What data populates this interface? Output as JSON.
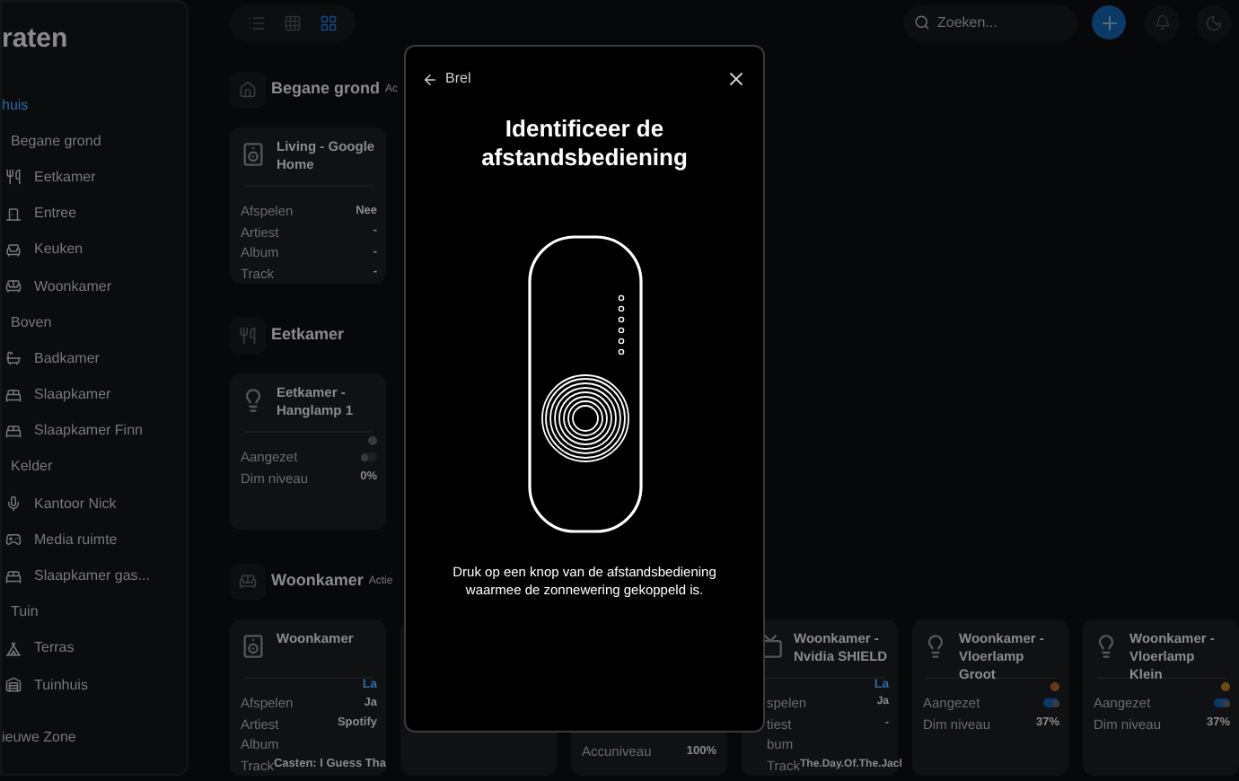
{
  "sidebar": {
    "title": "raten",
    "items": [
      {
        "label": "huis",
        "kind": "home",
        "selected": true
      },
      {
        "label": "Begane grond",
        "kind": "group",
        "selected": false
      },
      {
        "label": "Eetkamer",
        "kind": "room",
        "selected": false
      },
      {
        "label": "Entree",
        "kind": "room",
        "selected": false
      },
      {
        "label": "Keuken",
        "kind": "room",
        "selected": false
      },
      {
        "label": "Woonkamer",
        "kind": "room",
        "selected": false
      },
      {
        "label": "Boven",
        "kind": "group",
        "selected": false
      },
      {
        "label": "Badkamer",
        "kind": "room",
        "selected": false
      },
      {
        "label": "Slaapkamer",
        "kind": "room",
        "selected": false
      },
      {
        "label": "Slaapkamer Finn",
        "kind": "room",
        "selected": false
      },
      {
        "label": "Kelder",
        "kind": "group",
        "selected": false
      },
      {
        "label": "Kantoor Nick",
        "kind": "room",
        "selected": false
      },
      {
        "label": "Media ruimte",
        "kind": "room",
        "selected": false
      },
      {
        "label": "Slaapkamer gas...",
        "kind": "room",
        "selected": false
      },
      {
        "label": "Tuin",
        "kind": "group",
        "selected": false
      },
      {
        "label": "Terras",
        "kind": "room",
        "selected": false
      },
      {
        "label": "Tuinhuis",
        "kind": "room",
        "selected": false
      }
    ],
    "footer": "ieuwe Zone"
  },
  "toolbar": {
    "views": [
      {
        "selected": false
      },
      {
        "selected": false
      },
      {
        "selected": true
      }
    ],
    "search": {
      "placeholder": "Zoeken..."
    }
  },
  "sections": [
    {
      "title": "Begane grond",
      "action": "Ac",
      "cards": [
        {
          "kind": "media",
          "title": "Living - Google Home",
          "rows": [
            {
              "label": "Afspelen",
              "value": "Nee"
            },
            {
              "label": "Artiest",
              "value": "-"
            },
            {
              "label": "Album",
              "value": "-"
            },
            {
              "label": "Track",
              "value": "-"
            }
          ]
        }
      ]
    },
    {
      "title": "Eetkamer",
      "cards": [
        {
          "kind": "light",
          "title": "Eetkamer - Hanglamp 1",
          "color": "#3a3a3a",
          "on": false,
          "rows": [
            {
              "label": "Aangezet"
            },
            {
              "label": "Dim niveau",
              "value": "0%"
            }
          ]
        }
      ]
    },
    {
      "title": "Woonkamer",
      "action": "Actie",
      "cards": [
        {
          "kind": "media",
          "title": "Woonkamer",
          "status": "La",
          "rows": [
            {
              "label": "Afspelen",
              "value": "Ja"
            },
            {
              "label": "Artiest",
              "value": "Spotify"
            },
            {
              "label": "Album"
            },
            {
              "label": "Track",
              "value": "Casten: I Guess Tha"
            }
          ]
        },
        {
          "kind": "hidden"
        },
        {
          "kind": "battery",
          "rows": [
            {
              "label": "Accuniveau",
              "value": "100%"
            }
          ]
        },
        {
          "kind": "media",
          "title": "Woonkamer - Nvidia SHIELD",
          "status": "La",
          "cut": true,
          "rows": [
            {
              "label": "spelen",
              "value": "Ja"
            },
            {
              "label": "tiest",
              "value": "-"
            },
            {
              "label": "bum"
            },
            {
              "label": "Track",
              "value": "The.Day.Of.The.Jacl"
            }
          ]
        },
        {
          "kind": "light",
          "title": "Woonkamer - Vloerlamp Groot",
          "color": "#6b3a14",
          "on": true,
          "rows": [
            {
              "label": "Aangezet"
            },
            {
              "label": "Dim niveau",
              "value": "37%"
            }
          ]
        },
        {
          "kind": "light",
          "title": "Woonkamer - Vloerlamp Klein",
          "color": "#6b4a14",
          "on": true,
          "rows": [
            {
              "label": "Aangezet"
            },
            {
              "label": "Dim niveau",
              "value": "37%"
            }
          ]
        }
      ]
    }
  ],
  "dialog": {
    "back": "Brel",
    "title": "Identificeer de afstandsbediening",
    "instruction": "Druk op een knop van de afstandsbediening waarmee de zonnewering gekoppeld is."
  }
}
